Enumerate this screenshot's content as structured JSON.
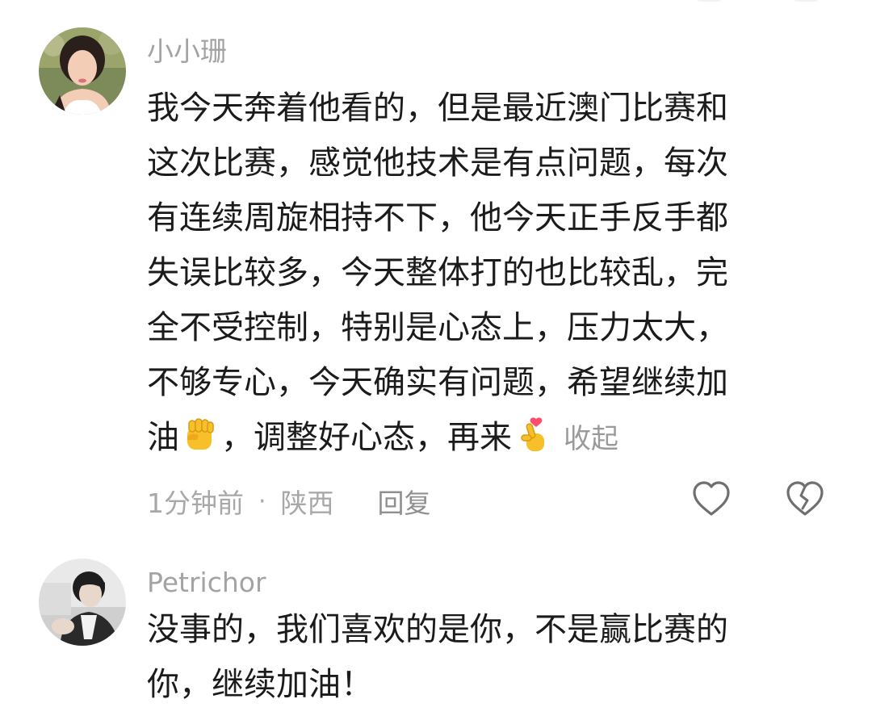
{
  "comments": [
    {
      "author": "小小珊",
      "text_lines": [
        "我今天奔着他看的，但是最近澳门比赛和",
        "这次比赛，感觉他技术是有点问题，每次",
        "有连续周旋相持不下，他今天正手反手都",
        "失误比较多，今天整体打的也比较乱，完",
        "全不受控制，特别是心态上，压力太大，",
        "不够专心，今天确实有问题，希望继续加"
      ],
      "last_line": {
        "before_fist": "油",
        "after_fist": "，调整好心态，再来"
      },
      "emoji": [
        "raised-fist",
        "hand-with-index-finger-and-thumb-crossed"
      ],
      "collapse_label": "收起",
      "time": "1分钟前",
      "separator": "·",
      "location": "陕西",
      "reply_label": "回复",
      "icons": [
        "heart-outline",
        "broken-heart-outline"
      ]
    },
    {
      "author": "Petrichor",
      "text_lines": [
        "没事的，我们喜欢的是你，不是赢比赛的",
        "你，继续加油！"
      ]
    }
  ],
  "colors": {
    "text": "#1b1b1b",
    "muted": "#a3a3a3",
    "icon": "#6f6f6f",
    "emoji_yellow": "#f7c02b",
    "emoji_heart": "#ff4d6d"
  }
}
